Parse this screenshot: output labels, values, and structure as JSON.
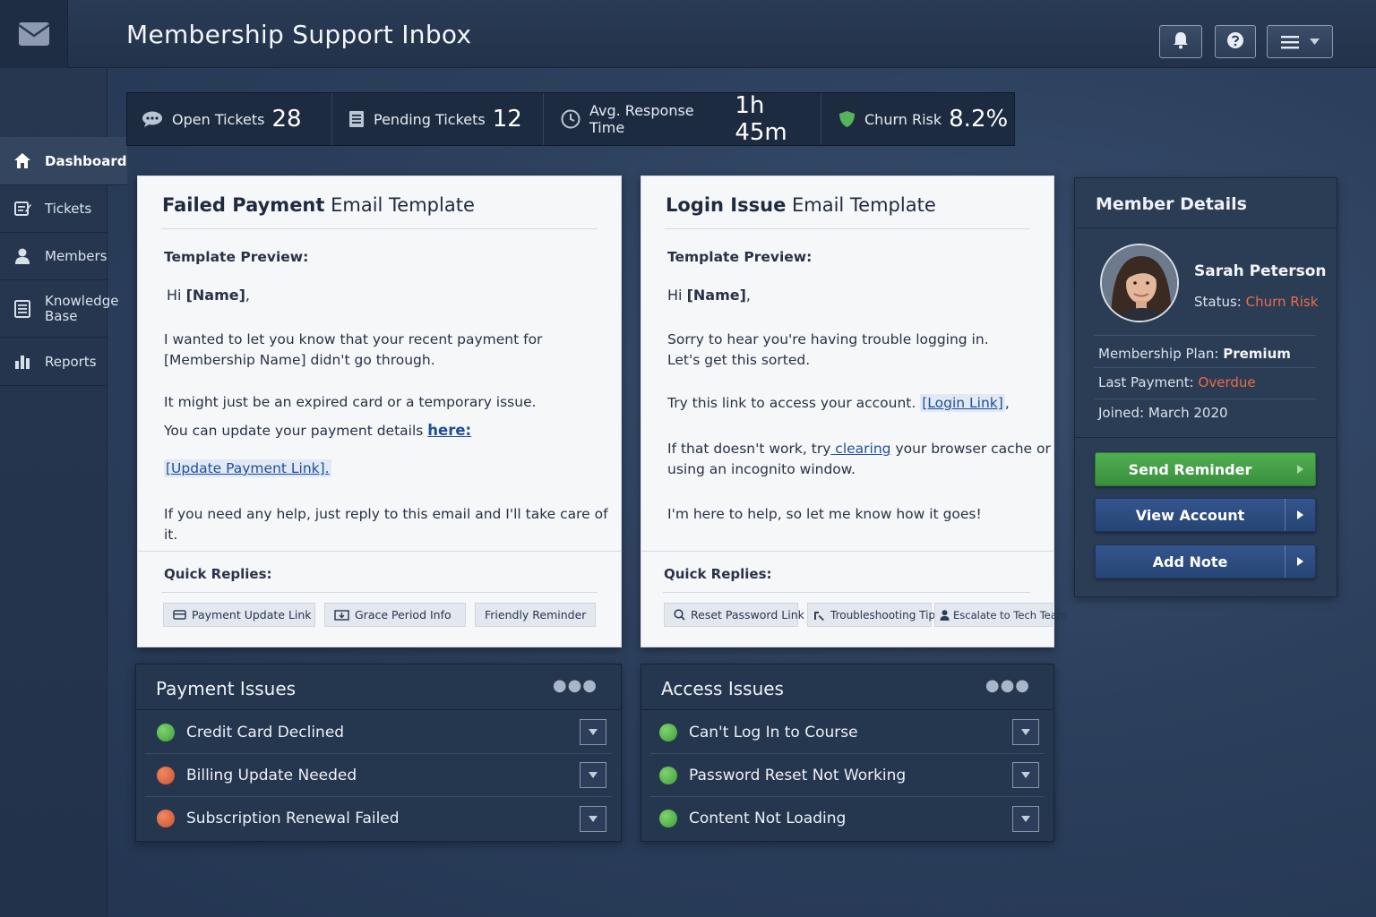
{
  "app": {
    "title": "Membership Support Inbox"
  },
  "sidebar": {
    "items": [
      {
        "label": "Dashboard",
        "icon": "home-icon",
        "active": true
      },
      {
        "label": "Tickets",
        "icon": "edit-icon"
      },
      {
        "label": "Members",
        "icon": "user-icon"
      },
      {
        "label": "Knowledge Base",
        "icon": "list-icon"
      },
      {
        "label": "Reports",
        "icon": "bar-chart-icon"
      }
    ]
  },
  "stats": [
    {
      "label": "Open Tickets",
      "value": "28",
      "icon": "chat-icon"
    },
    {
      "label": "Pending Tickets",
      "value": "12",
      "icon": "document-icon"
    },
    {
      "label": "Avg. Response Time",
      "value": "1h 45m",
      "icon": "clock-icon"
    },
    {
      "label": "Churn Risk",
      "value": "8.2%",
      "icon": "shield-icon"
    }
  ],
  "templates": [
    {
      "title_bold": "Failed Payment",
      "title_rest": " Email Template",
      "preview_label": "Template Preview:",
      "greeting": "Hi",
      "greeting_name": "[Name]",
      "greeting_end": ",",
      "p1a": "I wanted to let you know that your recent payment for",
      "p1b": "[Membership Name] didn't go through.",
      "p2": "It might just be an expired card or a temporary issue.",
      "p3_text": "You can update your payment details ",
      "p3_link": "here:",
      "p4_link": "[Update Payment Link].",
      "p5": "If you need any help, just reply to this email and I'll take care of it.",
      "quick_label": "Quick Replies:",
      "chips": [
        "Payment Update Link",
        "Grace Period Info",
        "Friendly Reminder"
      ]
    },
    {
      "title_bold": "Login Issue",
      "title_rest": " Email Template",
      "preview_label": "Template Preview:",
      "greeting": "Hi",
      "greeting_name": "[Name]",
      "greeting_end": ",",
      "p1a": "Sorry to hear you're having trouble logging in.",
      "p1b": "Let's get this sorted.",
      "p2_text": "Try this link to access your account. ",
      "p2_link": "[Login Link]",
      "p2_end": ",",
      "p3_text": "If that doesn't work, try",
      "p3_link": " clearing",
      "p3_end": " your browser cache or",
      "p3b": "using an incognito window.",
      "p4": "I'm here to help, so let me know how it goes!",
      "quick_label": "Quick Replies:",
      "chips": [
        "Reset Password Link",
        "Troubleshooting Tips",
        "Escalate to Tech Team"
      ]
    }
  ],
  "member": {
    "header": "Member Details",
    "name": "Sarah Peterson",
    "status_label": "Status:",
    "status_value": "Churn Risk",
    "plan_label": "Membership Plan:",
    "plan_value": "Premium",
    "payment_label": "Last Payment:",
    "payment_value": "Overdue",
    "joined_label": "Joined:",
    "joined_value": "March 2020",
    "buttons": [
      "Send Reminder",
      "View Account",
      "Add Note"
    ],
    "status_color": "#ef6b48"
  },
  "issue_panels": [
    {
      "title": "Payment Issues",
      "items": [
        {
          "label": "Credit Card Declined",
          "status": "green"
        },
        {
          "label": "Billing Update Needed",
          "status": "red"
        },
        {
          "label": "Subscription Renewal Failed",
          "status": "red"
        }
      ]
    },
    {
      "title": "Access Issues",
      "items": [
        {
          "label": "Can't Log In to Course",
          "status": "green"
        },
        {
          "label": "Password Reset Not Working",
          "status": "green"
        },
        {
          "label": "Content Not Loading",
          "status": "green"
        }
      ]
    }
  ],
  "colors": {
    "accent_green": "#4fae51",
    "accent_blue": "#264575",
    "link": "#1f4f9a"
  }
}
